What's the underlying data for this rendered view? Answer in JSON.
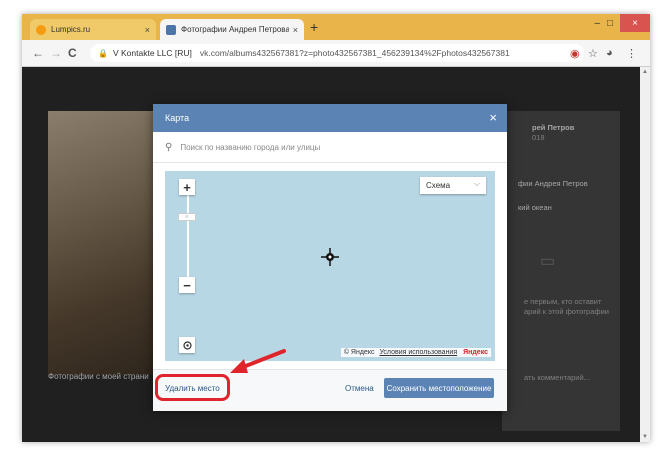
{
  "browser": {
    "tabs": [
      {
        "label": "Lumpics.ru",
        "close": "×"
      },
      {
        "label": "Фотографии Андрея Петрова -",
        "close": "×"
      }
    ],
    "new_tab": "+",
    "window_controls": {
      "minimize": "–",
      "maximize": "□",
      "close": "×"
    },
    "nav": {
      "back": "←",
      "forward": "→",
      "reload": "C"
    },
    "address": {
      "lock": "🔒",
      "site": "V Kontakte LLC [RU]",
      "url": "vk.com/albums432567381?z=photo432567381_456239134%2Fphotos432567381"
    }
  },
  "background": {
    "photo_caption": "Фотографии с моей страни",
    "panel": {
      "name": "рей Петров",
      "year": "018",
      "album": "фии Андрея Петров",
      "location": "кий океан",
      "comment_hint_1": "е первым, кто оставит",
      "comment_hint_2": "арий к этой фотографии",
      "comment_input": "ать комментарий..."
    }
  },
  "modal": {
    "title": "Карта",
    "close": "×",
    "search_placeholder": "Поиск по названию города или улицы",
    "map": {
      "zoom_in": "+",
      "zoom_out": "−",
      "layer_select": "Схема",
      "attribution_copy": "© Яндекс",
      "attribution_terms": "Условия использования",
      "attribution_logo": "Яндекс"
    },
    "footer": {
      "delete_label": "Удалить место",
      "cancel_label": "Отмена",
      "save_label": "Сохранить местоположение"
    }
  },
  "colors": {
    "header_blue": "#5b84b5",
    "map_water": "#b8d7e4",
    "highlight_red": "#e0242b",
    "link_blue": "#2a5885"
  }
}
